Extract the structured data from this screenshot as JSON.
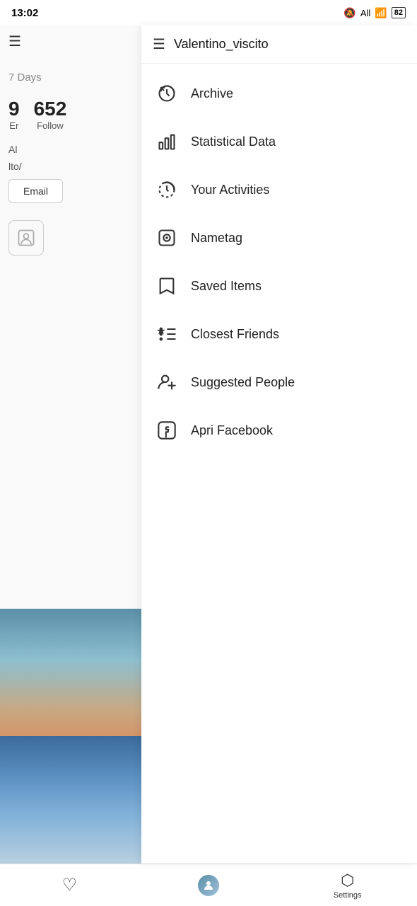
{
  "statusBar": {
    "time": "13:02",
    "networkType": "All",
    "batteryLevel": "82"
  },
  "profile": {
    "days_label": "7 Days",
    "stats": [
      {
        "number": "9",
        "label": "Er"
      },
      {
        "number": "652",
        "label": "Follow"
      }
    ],
    "label_al": "Al",
    "label_lto": "lto/",
    "email_button": "Email"
  },
  "dropdown": {
    "username": "Valentino_viscito",
    "menu_items": [
      {
        "id": "archive",
        "label": "Archive",
        "icon": "archive"
      },
      {
        "id": "statistical-data",
        "label": "Statistical Data",
        "icon": "bar-chart"
      },
      {
        "id": "your-activities",
        "label": "Your Activities",
        "icon": "activity"
      },
      {
        "id": "nametag",
        "label": "Nametag",
        "icon": "nametag"
      },
      {
        "id": "saved-items",
        "label": "Saved Items",
        "icon": "bookmark"
      },
      {
        "id": "closest-friends",
        "label": "Closest Friends",
        "icon": "star-list"
      },
      {
        "id": "suggested-people",
        "label": "Suggested People",
        "icon": "add-person"
      },
      {
        "id": "apri-facebook",
        "label": "Apri Facebook",
        "icon": "facebook"
      }
    ]
  },
  "bottomNav": {
    "items": [
      {
        "id": "heart",
        "icon": "♡",
        "label": ""
      },
      {
        "id": "profile",
        "icon": "👤",
        "label": ""
      },
      {
        "id": "settings",
        "icon": "⬡",
        "label": "Settings"
      }
    ]
  }
}
